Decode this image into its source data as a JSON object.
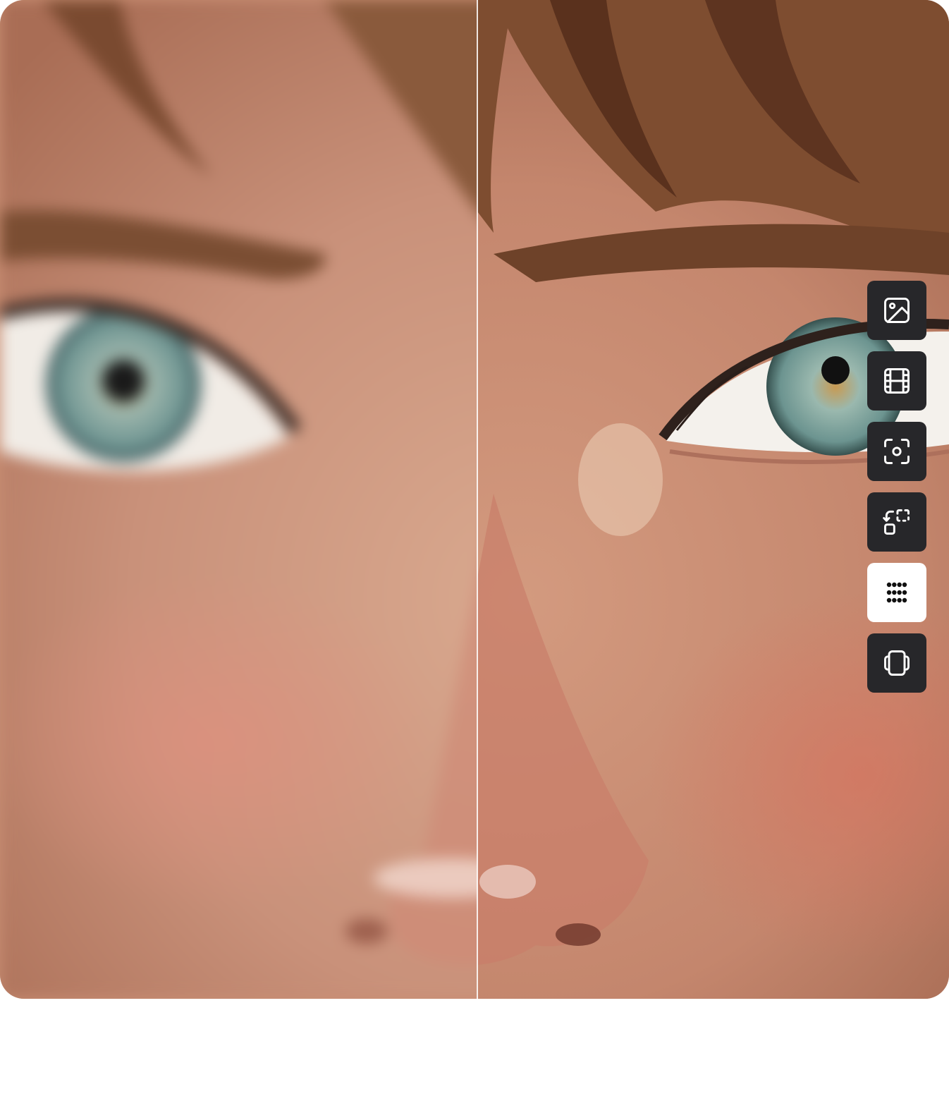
{
  "viewer": {
    "mode": "before-after-comparison",
    "left_panel": "blurred-original",
    "right_panel": "enhanced-result"
  },
  "colors": {
    "toolbar_button": "#27272a",
    "toolbar_button_active": "#ffffff",
    "divider": "#ffffff"
  },
  "toolbar": {
    "items": [
      {
        "icon": "image-icon",
        "active": false
      },
      {
        "icon": "film-icon",
        "active": false
      },
      {
        "icon": "focus-icon",
        "active": false
      },
      {
        "icon": "resize-icon",
        "active": false
      },
      {
        "icon": "dot-grid-icon",
        "active": true
      },
      {
        "icon": "layers-icon",
        "active": false
      }
    ]
  }
}
